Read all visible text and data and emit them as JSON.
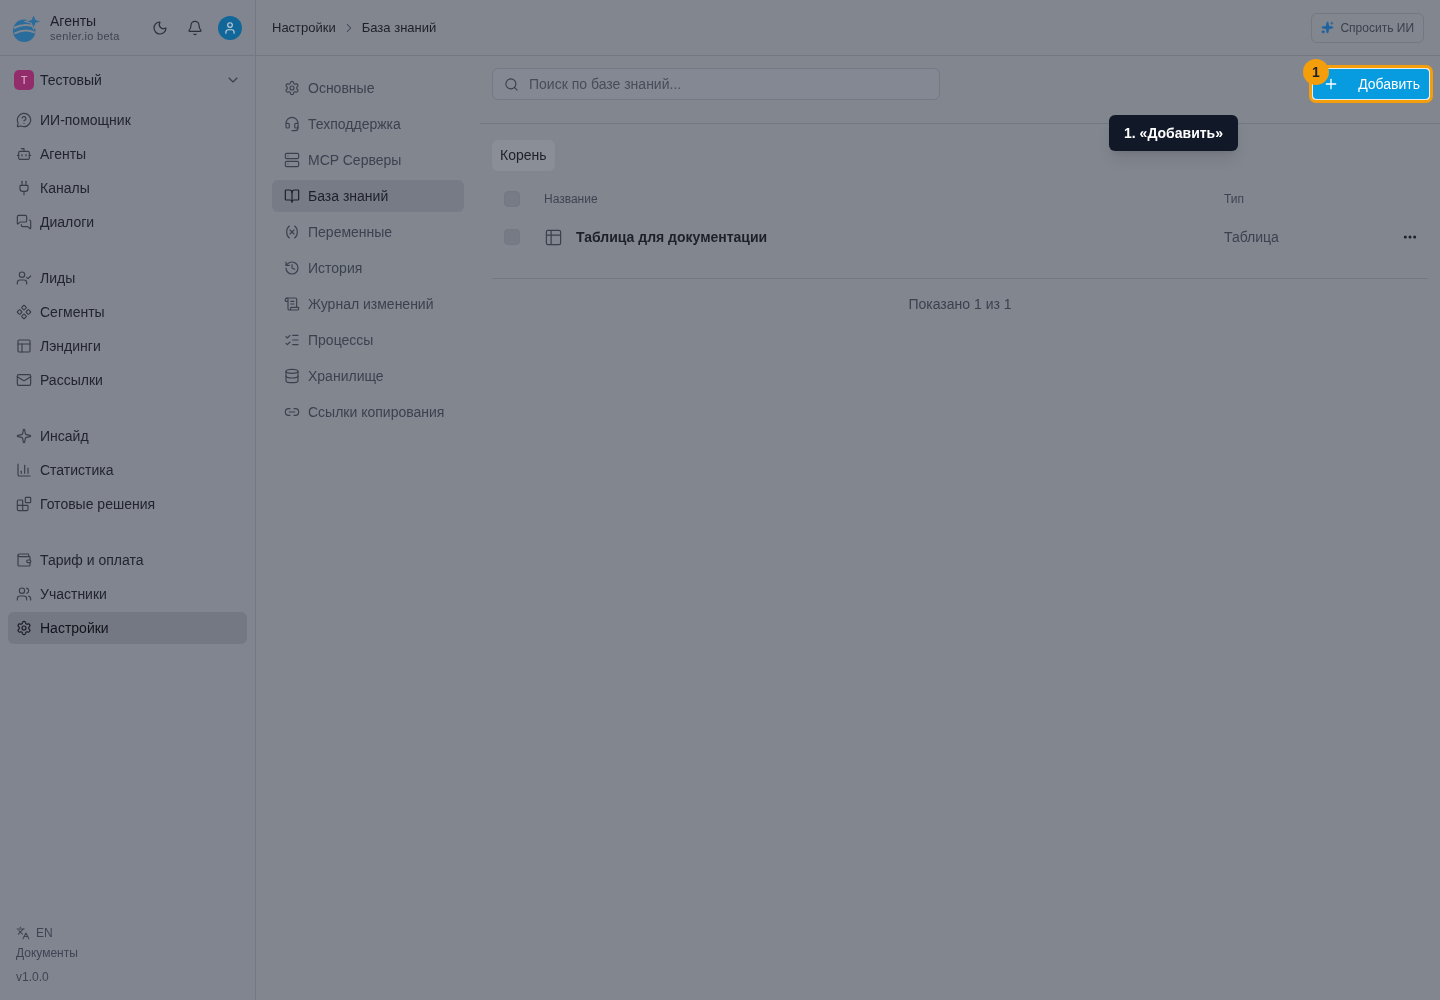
{
  "app": {
    "title": "Агенты",
    "subtitle": "senler.io beta"
  },
  "workspace": {
    "initial": "Т",
    "name": "Тестовый"
  },
  "sidebar": {
    "sections": [
      {
        "items": [
          {
            "label": "ИИ-помощник",
            "selected": false
          },
          {
            "label": "Агенты",
            "selected": false
          },
          {
            "label": "Каналы",
            "selected": false
          },
          {
            "label": "Диалоги",
            "selected": false
          }
        ]
      },
      {
        "items": [
          {
            "label": "Лиды",
            "selected": false
          },
          {
            "label": "Сегменты",
            "selected": false
          },
          {
            "label": "Лэндинги",
            "selected": false
          },
          {
            "label": "Рассылки",
            "selected": false
          }
        ]
      },
      {
        "items": [
          {
            "label": "Инсайд",
            "selected": false
          },
          {
            "label": "Статистика",
            "selected": false
          },
          {
            "label": "Готовые решения",
            "selected": false
          }
        ]
      },
      {
        "items": [
          {
            "label": "Тариф и оплата",
            "selected": false
          },
          {
            "label": "Участники",
            "selected": false
          },
          {
            "label": "Настройки",
            "selected": true
          }
        ]
      }
    ]
  },
  "sidebar_footer": {
    "language": "EN",
    "docs_link": "Документы",
    "version": "v1.0.0"
  },
  "breadcrumbs": [
    {
      "label": "Настройки"
    },
    {
      "label": "База знаний"
    }
  ],
  "ask_ai_button": {
    "label": "Спросить ИИ"
  },
  "settings_nav": {
    "items": [
      {
        "label": "Основные",
        "selected": false
      },
      {
        "label": "Техподдержка",
        "selected": false
      },
      {
        "label": "MCP Серверы",
        "selected": false
      },
      {
        "label": "База знаний",
        "selected": true
      },
      {
        "label": "Переменные",
        "selected": false
      },
      {
        "label": "История",
        "selected": false
      },
      {
        "label": "Журнал изменений",
        "selected": false
      },
      {
        "label": "Процессы",
        "selected": false
      },
      {
        "label": "Хранилище",
        "selected": false
      },
      {
        "label": "Ссылки копирования",
        "selected": false
      }
    ]
  },
  "search": {
    "placeholder": "Поиск по базе знаний..."
  },
  "add_button": {
    "label": "Добавить"
  },
  "tour": {
    "badge": "1",
    "tooltip": "1. «Добавить»"
  },
  "folder_path": [
    {
      "label": "Корень"
    }
  ],
  "table": {
    "select_all_checked": false,
    "columns": [
      "Название",
      "Тип"
    ],
    "rows": [
      {
        "name": "Таблица для документации",
        "type": "Таблица",
        "checked": false
      }
    ]
  },
  "pagination": {
    "summary": "Показано 1 из 1"
  }
}
